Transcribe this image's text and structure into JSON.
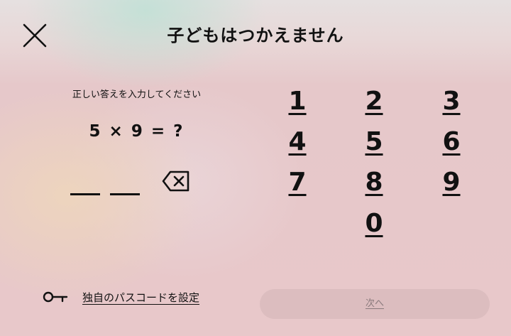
{
  "header": {
    "title": "子どもはつかえません"
  },
  "quiz": {
    "instruction": "正しい答えを入力してください",
    "question": "5 × 9 = ?",
    "answer_slots": [
      "",
      ""
    ]
  },
  "keypad": {
    "keys": [
      "1",
      "2",
      "3",
      "4",
      "5",
      "6",
      "7",
      "8",
      "9",
      "0"
    ]
  },
  "footer": {
    "passcode_label": "独自のパスコードを設定",
    "next_label": "次へ"
  },
  "icons": {
    "close": "close-icon",
    "backspace": "backspace-icon",
    "key": "key-icon"
  }
}
